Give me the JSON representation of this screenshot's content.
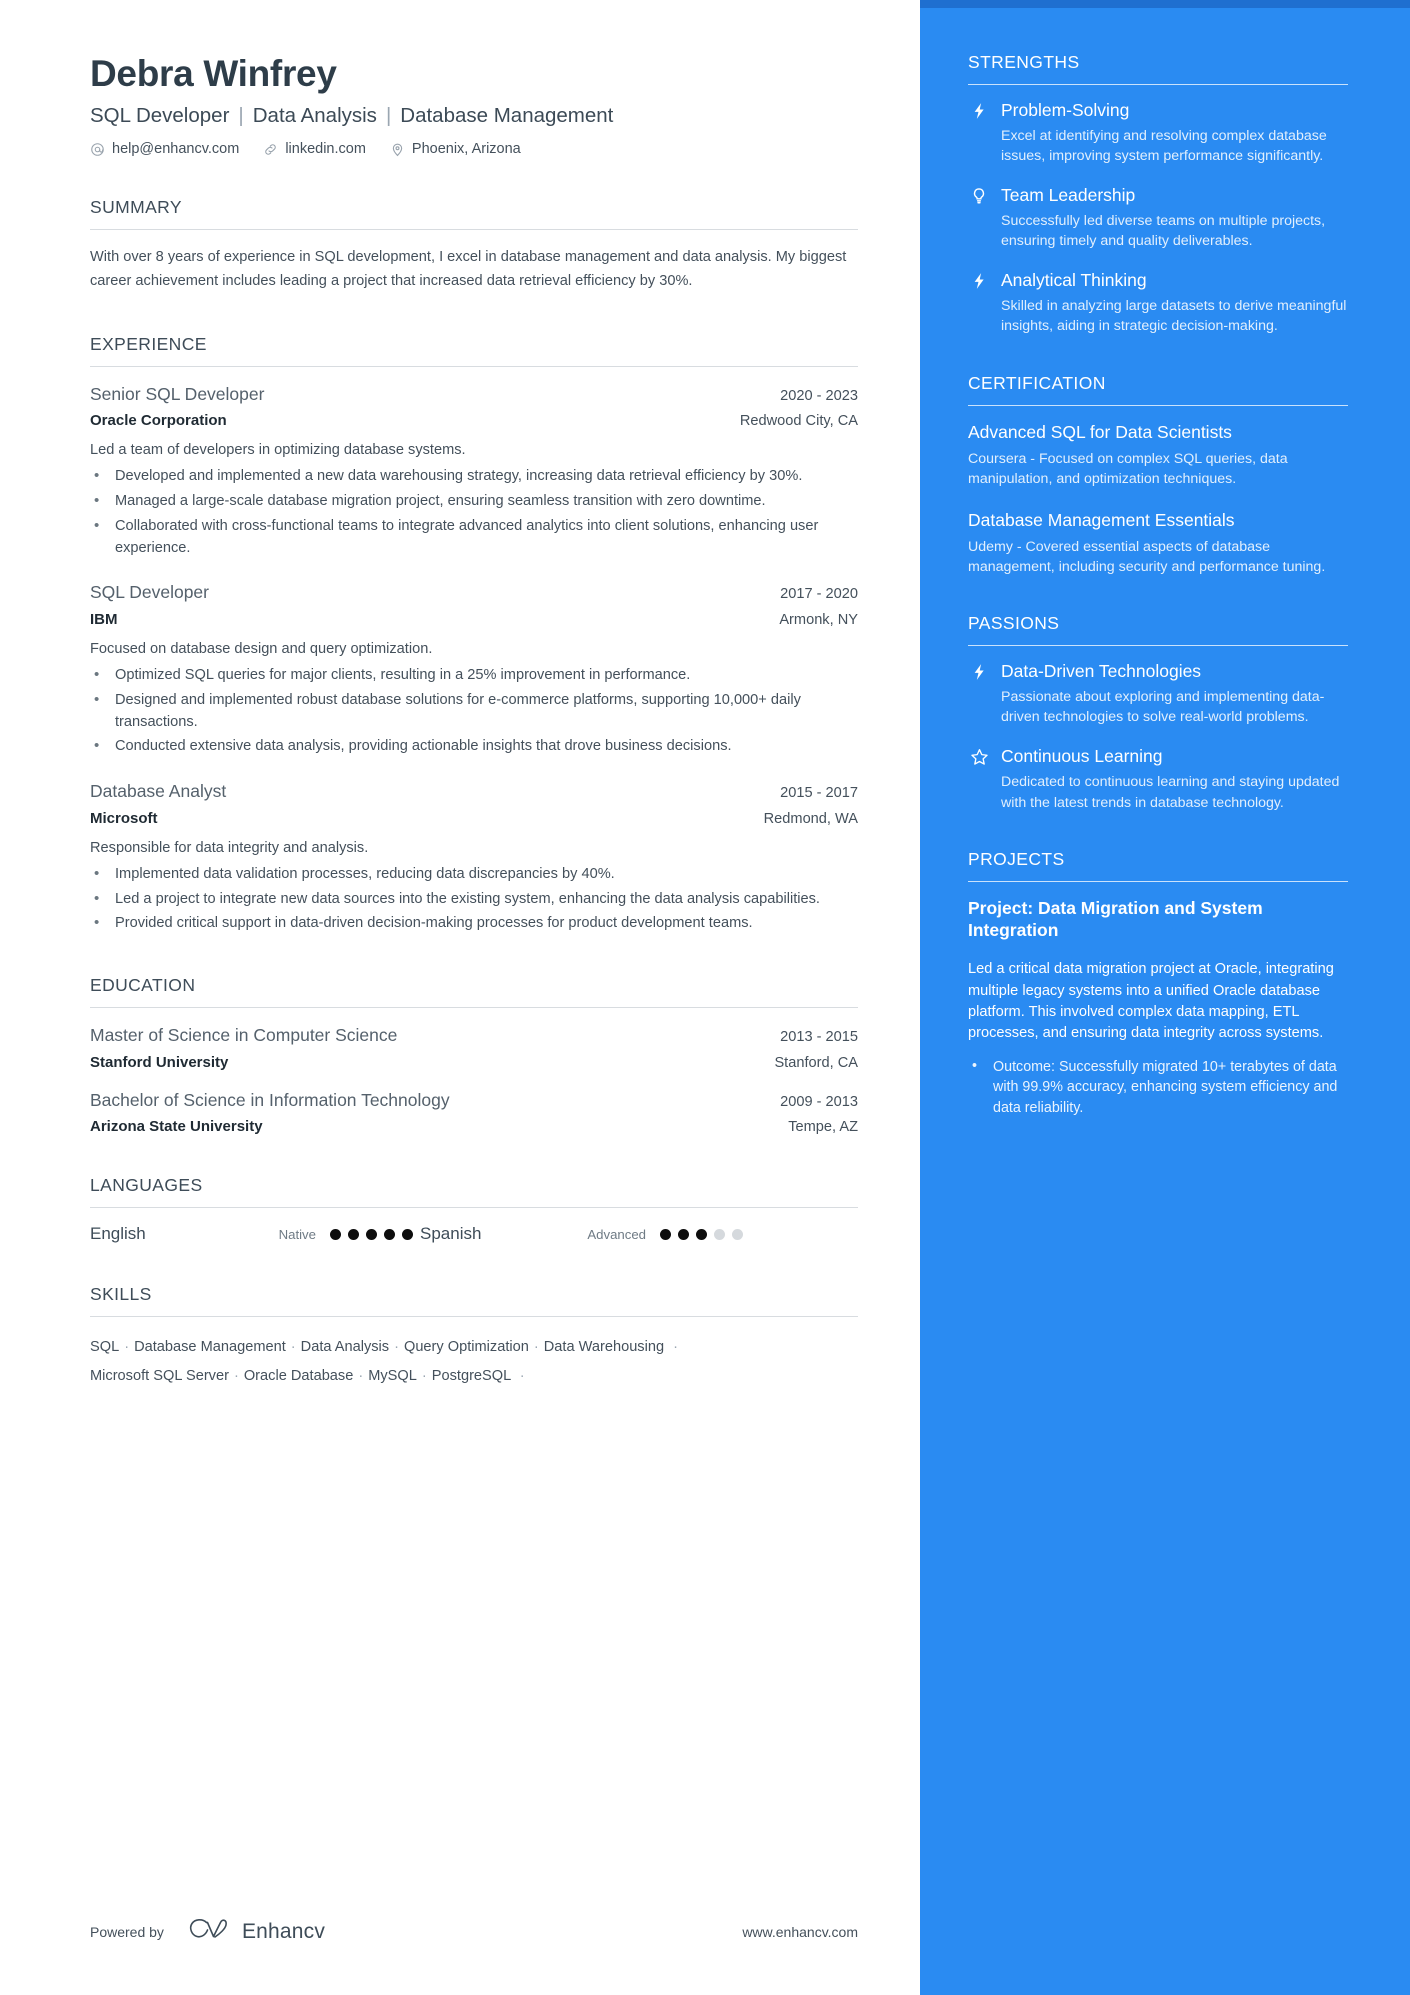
{
  "header": {
    "name": "Debra Winfrey",
    "headline_parts": [
      "SQL Developer",
      "Data Analysis",
      "Database Management"
    ],
    "contacts": [
      {
        "icon": "at-sign-icon",
        "text": "help@enhancv.com"
      },
      {
        "icon": "link-icon",
        "text": "linkedin.com"
      },
      {
        "icon": "map-pin-icon",
        "text": "Phoenix, Arizona"
      }
    ]
  },
  "summary": {
    "title": "SUMMARY",
    "text": "With over 8 years of experience in SQL development, I excel in database management and data analysis. My biggest career achievement includes leading a project that increased data retrieval efficiency by 30%."
  },
  "experience": {
    "title": "EXPERIENCE",
    "entries": [
      {
        "role": "Senior SQL Developer",
        "date": "2020 - 2023",
        "org": "Oracle Corporation",
        "location": "Redwood City, CA",
        "desc": "Led a team of developers in optimizing database systems.",
        "bullets": [
          "Developed and implemented a new data warehousing strategy, increasing data retrieval efficiency by 30%.",
          "Managed a large-scale database migration project, ensuring seamless transition with zero downtime.",
          "Collaborated with cross-functional teams to integrate advanced analytics into client solutions, enhancing user experience."
        ]
      },
      {
        "role": "SQL Developer",
        "date": "2017 - 2020",
        "org": "IBM",
        "location": "Armonk, NY",
        "desc": "Focused on database design and query optimization.",
        "bullets": [
          "Optimized SQL queries for major clients, resulting in a 25% improvement in performance.",
          "Designed and implemented robust database solutions for e-commerce platforms, supporting 10,000+ daily transactions.",
          "Conducted extensive data analysis, providing actionable insights that drove business decisions."
        ]
      },
      {
        "role": "Database Analyst",
        "date": "2015 - 2017",
        "org": "Microsoft",
        "location": "Redmond, WA",
        "desc": "Responsible for data integrity and analysis.",
        "bullets": [
          "Implemented data validation processes, reducing data discrepancies by 40%.",
          "Led a project to integrate new data sources into the existing system, enhancing the data analysis capabilities.",
          "Provided critical support in data-driven decision-making processes for product development teams."
        ]
      }
    ]
  },
  "education": {
    "title": "EDUCATION",
    "entries": [
      {
        "degree": "Master of Science in Computer Science",
        "date": "2013 - 2015",
        "school": "Stanford University",
        "location": "Stanford, CA"
      },
      {
        "degree": "Bachelor of Science in Information Technology",
        "date": "2009 - 2013",
        "school": "Arizona State University",
        "location": "Tempe, AZ"
      }
    ]
  },
  "languages": {
    "title": "LANGUAGES",
    "items": [
      {
        "name": "English",
        "level": "Native",
        "filled": 5,
        "total": 5
      },
      {
        "name": "Spanish",
        "level": "Advanced",
        "filled": 3,
        "total": 5
      }
    ]
  },
  "skills": {
    "title": "SKILLS",
    "lines": [
      [
        "SQL",
        "Database Management",
        "Data Analysis",
        "Query Optimization",
        "Data Warehousing"
      ],
      [
        "Microsoft SQL Server",
        "Oracle Database",
        "MySQL",
        "PostgreSQL"
      ]
    ]
  },
  "footer": {
    "powered_by": "Powered by",
    "brand": "Enhancv",
    "website": "www.enhancv.com"
  },
  "strengths": {
    "title": "STRENGTHS",
    "items": [
      {
        "icon": "lightning-bolt-icon",
        "name": "Problem-Solving",
        "desc": "Excel at identifying and resolving complex database issues, improving system performance significantly."
      },
      {
        "icon": "lightbulb-icon",
        "name": "Team Leadership",
        "desc": "Successfully led diverse teams on multiple projects, ensuring timely and quality deliverables."
      },
      {
        "icon": "lightning-bolt-icon",
        "name": "Analytical Thinking",
        "desc": "Skilled in analyzing large datasets to derive meaningful insights, aiding in strategic decision-making."
      }
    ]
  },
  "certification": {
    "title": "CERTIFICATION",
    "items": [
      {
        "name": "Advanced SQL for Data Scientists",
        "desc": "Coursera - Focused on complex SQL queries, data manipulation, and optimization techniques."
      },
      {
        "name": "Database Management Essentials",
        "desc": "Udemy - Covered essential aspects of database management, including security and performance tuning."
      }
    ]
  },
  "passions": {
    "title": "PASSIONS",
    "items": [
      {
        "icon": "lightning-bolt-icon",
        "name": "Data-Driven Technologies",
        "desc": "Passionate about exploring and implementing data-driven technologies to solve real-world problems."
      },
      {
        "icon": "star-icon",
        "name": "Continuous Learning",
        "desc": "Dedicated to continuous learning and staying updated with the latest trends in database technology."
      }
    ]
  },
  "projects": {
    "title": "PROJECTS",
    "name": "Project: Data Migration and System Integration",
    "desc": "Led a critical data migration project at Oracle, integrating multiple legacy systems into a unified Oracle database platform. This involved complex data mapping, ETL processes, and ensuring data integrity across systems.",
    "bullets": [
      "Outcome: Successfully migrated 10+ terabytes of data with 99.9% accuracy, enhancing system efficiency and data reliability."
    ]
  },
  "colors": {
    "accent": "#2a8bf2",
    "accent_dark": "#1f6fd0",
    "text": "#44505b",
    "heading": "#3e4c58"
  }
}
